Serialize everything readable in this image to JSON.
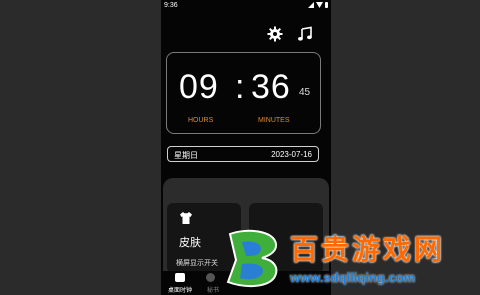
{
  "status_bar": {
    "time": "9:36"
  },
  "clock": {
    "hours": "09",
    "separator": ":",
    "minutes": "36",
    "seconds": "45",
    "hours_label": "HOURS",
    "minutes_label": "MINUTES"
  },
  "date_bar": {
    "weekday": "星期日",
    "date": "2023-07-16"
  },
  "cards": {
    "skin": {
      "title": "皮肤",
      "subtitle": "横屏显示开关"
    }
  },
  "bottom_nav": {
    "clock_label": "桌面时钟",
    "second_label": "秘书"
  },
  "watermark": {
    "title": "百贵游戏网",
    "url": "www.sdqlliqing.com"
  },
  "colors": {
    "accent": "#e08a2a",
    "background": "#050505",
    "panel": "#2c2c2c"
  },
  "icons": [
    "gear-icon",
    "music-icon",
    "shirt-icon"
  ]
}
